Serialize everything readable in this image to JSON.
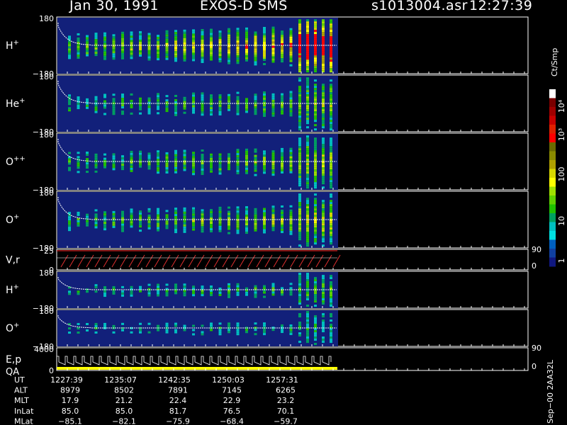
{
  "header": {
    "date": "Jan 30, 1991",
    "instrument": "EXOS-D SMS",
    "file": "s1013004.asr",
    "time": "12:27:39"
  },
  "colorbar": {
    "units": "Ct/Smp",
    "ticks": [
      "10⁴",
      "10³",
      "100",
      "10",
      "1"
    ],
    "colors": [
      "#ffffff",
      "#7a0000",
      "#a00000",
      "#c80000",
      "#e02000",
      "#ff0000",
      "#6a6a00",
      "#8a8a00",
      "#b0a000",
      "#d8d800",
      "#ffff00",
      "#a0e000",
      "#60d000",
      "#20c000",
      "#00a060",
      "#00c0c0",
      "#00e0e0",
      "#0060c0",
      "#1040a0",
      "#101880"
    ],
    "background": "#12207a"
  },
  "chart_data": {
    "type": "heatmap",
    "panels": [
      {
        "label": "H",
        "sup": "+",
        "ymax": "180",
        "ymin": "−180",
        "intensity": 1.0
      },
      {
        "label": "He",
        "sup": "+",
        "ymax": "180",
        "ymin": "−180",
        "intensity": 0.45
      },
      {
        "label": "O",
        "sup": "++",
        "ymax": "180",
        "ymin": "−180",
        "intensity": 0.55
      },
      {
        "label": "O",
        "sup": "+",
        "ymax": "180",
        "ymin": "−180",
        "intensity": 0.6
      },
      {
        "label": "V,r",
        "sup": "",
        "ymax": "25",
        "ymin": "0",
        "right_top": "90",
        "right_bottom": "0",
        "line_panel": true
      },
      {
        "label": "H",
        "sup": "+",
        "ymax": "180",
        "ymin": "−180",
        "intensity": 0.3
      },
      {
        "label": "O",
        "sup": "+",
        "ymax": "180",
        "ymin": "−180",
        "intensity": 0.15
      },
      {
        "label": "E,p",
        "sup": "",
        "label2": "QA",
        "ymax": "4000",
        "ymin": "0",
        "right_top": "90",
        "right_bottom": "0",
        "line_panel": true
      }
    ],
    "time_axis": {
      "rows": [
        {
          "name": "UT",
          "values": [
            "1227:39",
            "1235:07",
            "1242:35",
            "1250:03",
            "1257:31"
          ]
        },
        {
          "name": "ALT",
          "values": [
            "8979",
            "8502",
            "7891",
            "7145",
            "6265"
          ]
        },
        {
          "name": "MLT",
          "values": [
            "17.9",
            "21.2",
            "22.4",
            "22.9",
            "23.2"
          ]
        },
        {
          "name": "InLat",
          "values": [
            "85.0",
            "85.0",
            "81.7",
            "76.5",
            "70.1"
          ]
        },
        {
          "name": "MLat",
          "values": [
            "−85.1",
            "−82.1",
            "−75.9",
            "−68.4",
            "−59.7"
          ]
        }
      ]
    }
  },
  "footer": {
    "id": "Sep−00 2AA32L"
  }
}
